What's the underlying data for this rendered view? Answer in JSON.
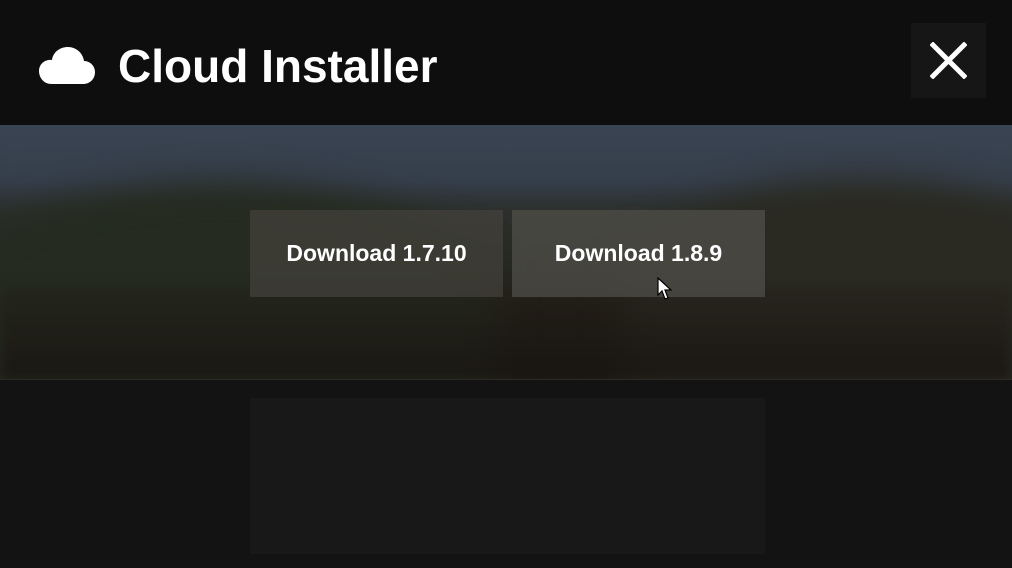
{
  "window": {
    "title": "Cloud Installer",
    "icon": "cloud-icon",
    "close_icon": "close-icon"
  },
  "actions": {
    "download_a_label": "Download 1.7.10",
    "download_b_label": "Download 1.8.9"
  },
  "colors": {
    "titlebar_bg": "#0e0e0e",
    "body_bg": "#131313",
    "button_bg": "#4a4843",
    "text": "#ffffff"
  }
}
